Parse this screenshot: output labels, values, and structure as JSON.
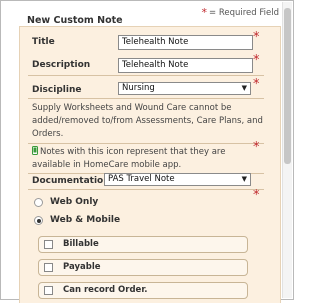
{
  "required_note": "= Required Field",
  "required_star": "*",
  "panel_title": "New Custom Note",
  "fields": {
    "title": {
      "label": "Title",
      "value": "Telehealth Note"
    },
    "description": {
      "label": "Description",
      "value": "Telehealth Note"
    },
    "discipline": {
      "label": "Discipline",
      "selected": "Nursing"
    },
    "documentation": {
      "label": "Documentation",
      "selected": "PAS Travel Note"
    }
  },
  "supply_note": "Supply Worksheets and Wound Care cannot be added/removed to/from Assessments, Care Plans, and Orders.",
  "mobile_note": "Notes with this icon represent that they are available in HomeCare mobile app.",
  "radios": {
    "web_only": {
      "label": "Web Only",
      "checked": false
    },
    "web_mobile": {
      "label": "Web & Mobile",
      "checked": true
    }
  },
  "options": [
    {
      "label": "Billable",
      "checked": false
    },
    {
      "label": "Payable",
      "checked": false
    },
    {
      "label": "Can record Order.",
      "checked": false
    }
  ],
  "colors": {
    "required": "#c0282d",
    "panel": "#fcf0e0",
    "mobile_icon": "#3a9a3a"
  },
  "icons": {
    "mobile": "mobile-icon",
    "dropdown": "chevron-down-icon"
  }
}
